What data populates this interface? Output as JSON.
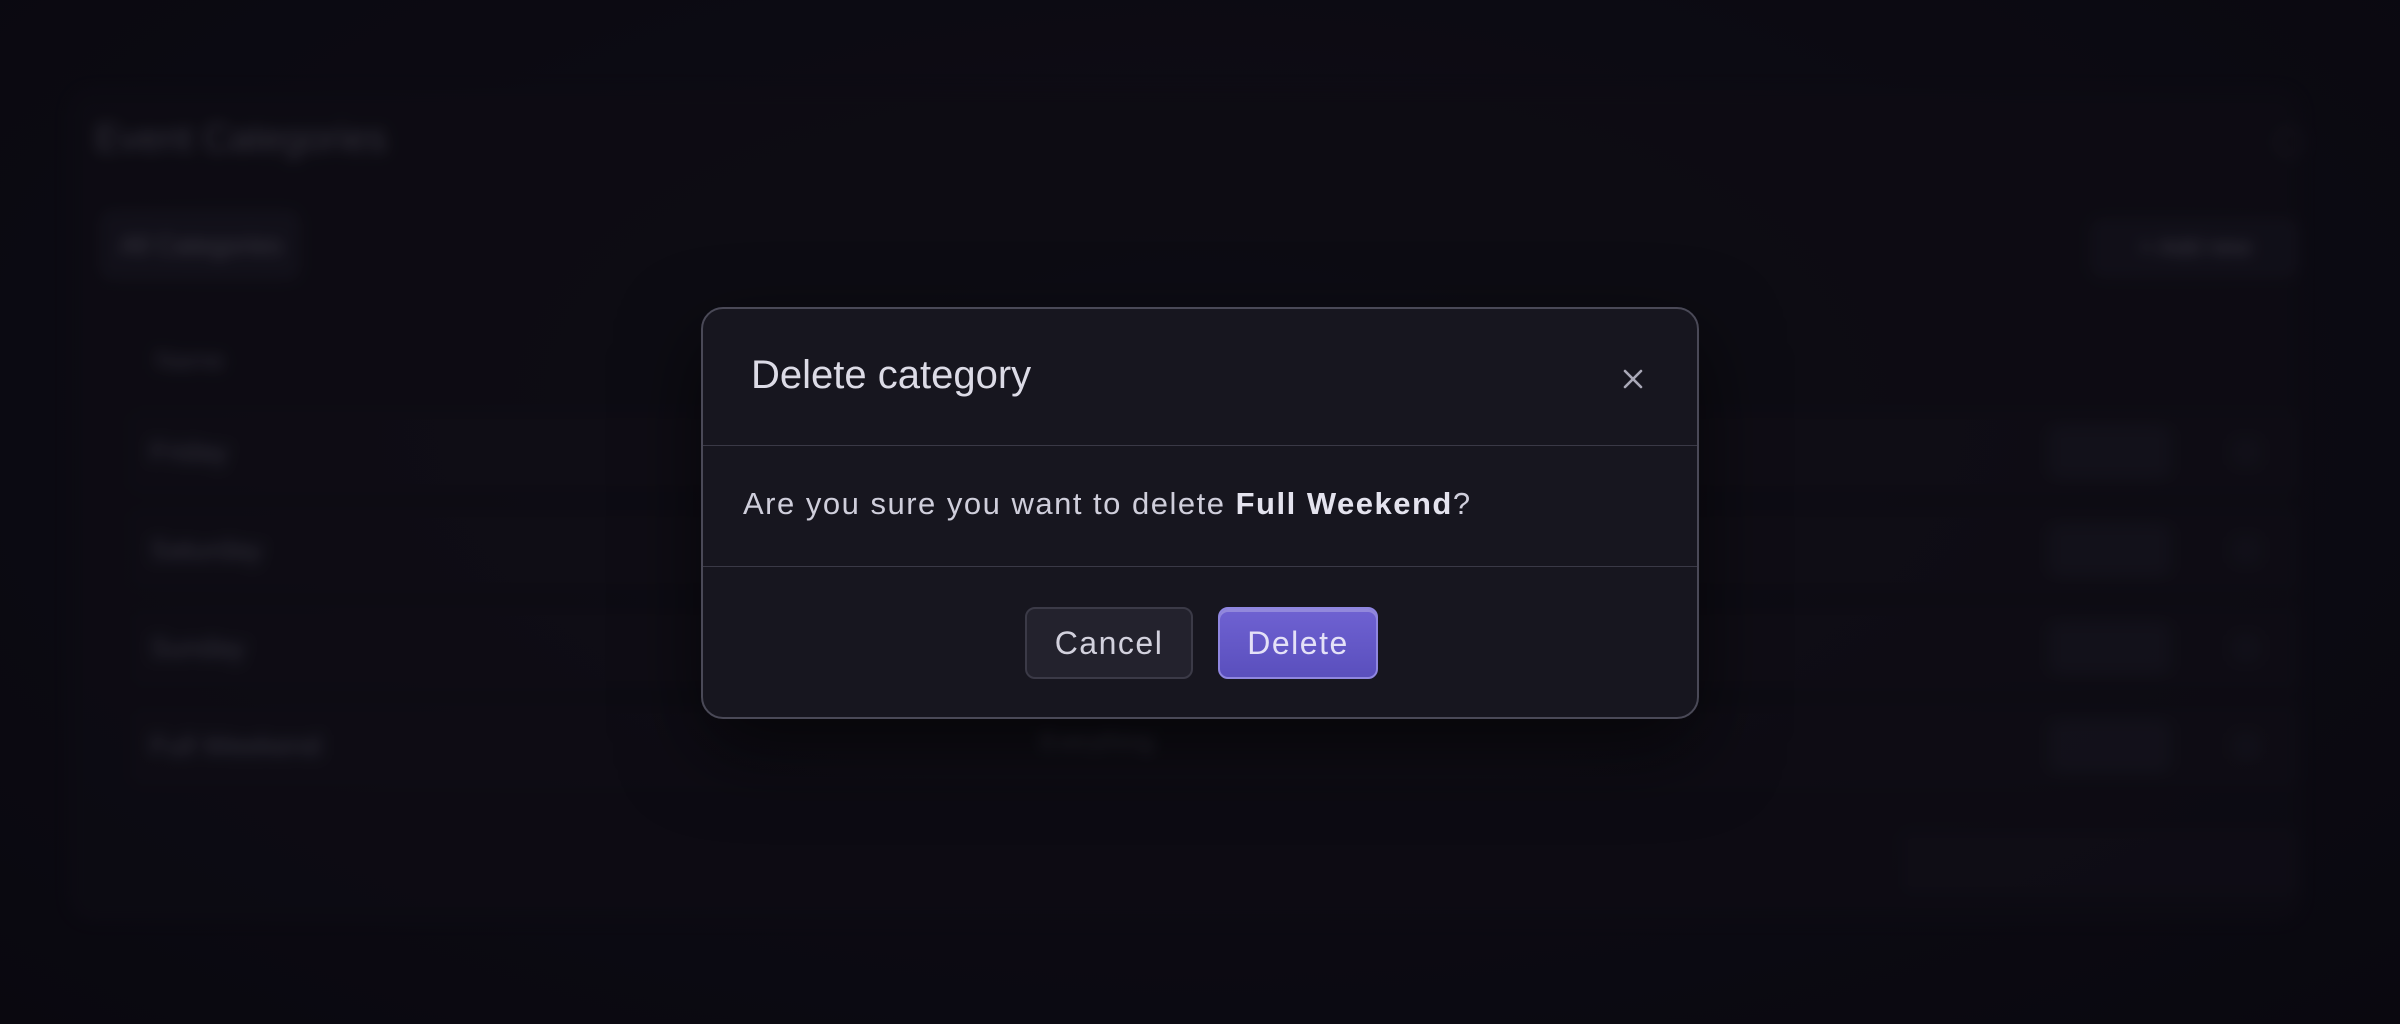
{
  "background": {
    "panel_title": "Event Categories",
    "filter_label": "All Categories",
    "add_label": "+ Add new",
    "column_header": "Name",
    "rows": [
      {
        "name": "Friday",
        "tag": ""
      },
      {
        "name": "Saturday",
        "tag": ""
      },
      {
        "name": "Sunday",
        "tag": ""
      },
      {
        "name": "Full Weekend",
        "tag": "Everything"
      }
    ]
  },
  "dialog": {
    "title": "Delete category",
    "message_prefix": "Are you sure you want to delete ",
    "target_name": "Full Weekend",
    "message_suffix": "?",
    "cancel_label": "Cancel",
    "delete_label": "Delete",
    "close_icon": "close-icon"
  },
  "colors": {
    "accent": "#6354c7",
    "surface": "#17161f",
    "border": "#4a4957"
  }
}
